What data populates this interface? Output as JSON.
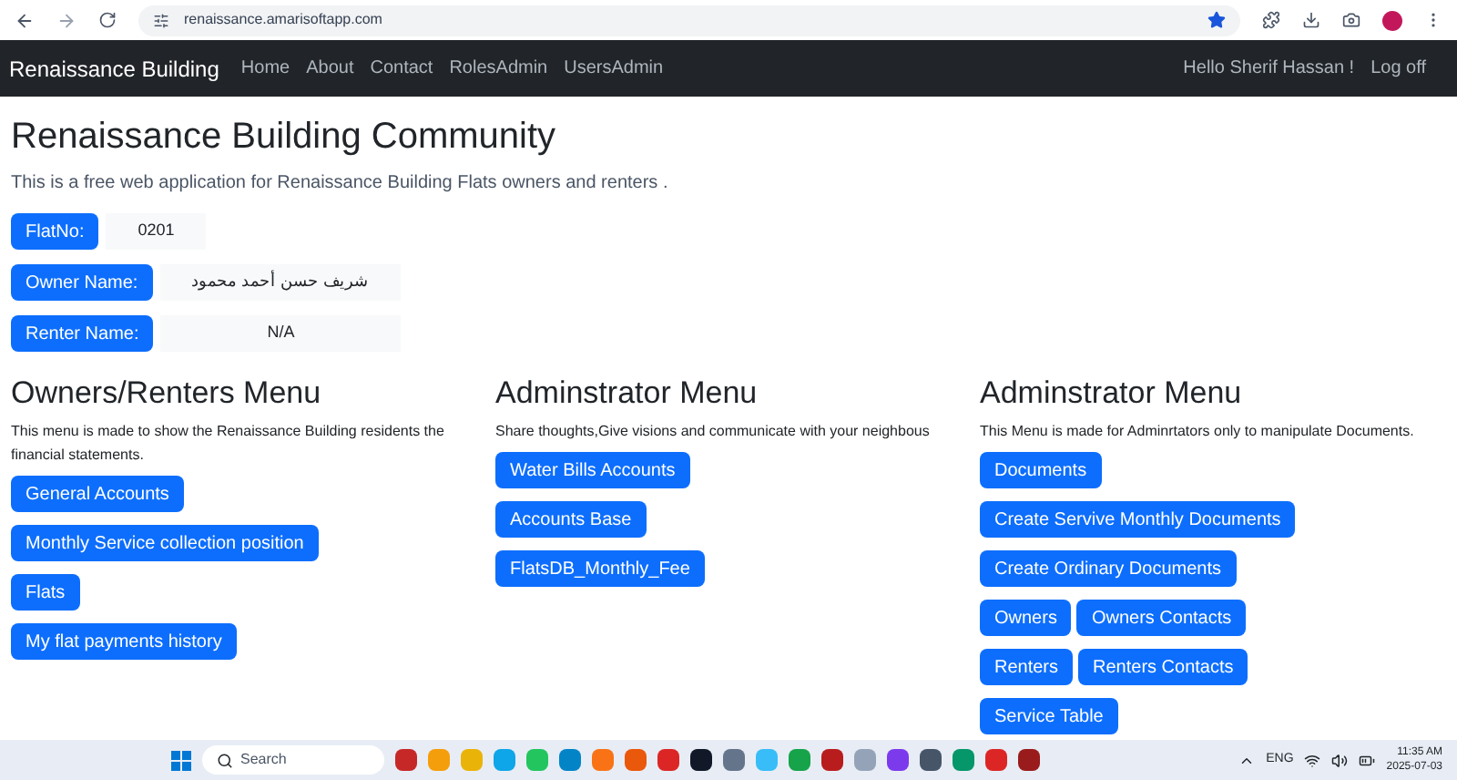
{
  "browser": {
    "url": "renaissance.amarisoftapp.com"
  },
  "navbar": {
    "brand": "Renaissance Building",
    "links": [
      "Home",
      "About",
      "Contact",
      "RolesAdmin",
      "UsersAdmin"
    ],
    "greeting": "Hello Sherif Hassan !",
    "logoff": "Log off"
  },
  "page": {
    "title": "Renaissance Building Community",
    "subtitle": "This is a free web application for Renaissance Building Flats owners and renters .",
    "fields": [
      {
        "label": "FlatNo:",
        "value": "0201"
      },
      {
        "label": "Owner Name:",
        "value": "شريف حسن أحمد محمود"
      },
      {
        "label": "Renter Name:",
        "value": "N/A"
      }
    ],
    "menus": [
      {
        "title": "Owners/Renters Menu",
        "description": "This menu is made to show the Renaissance Building residents the financial statements.",
        "rows": [
          [
            "General Accounts"
          ],
          [
            "Monthly Service collection position"
          ],
          [
            "Flats"
          ],
          [
            "My flat payments history"
          ]
        ]
      },
      {
        "title": "Adminstrator Menu",
        "description": "Share thoughts,Give visions and communicate with your neighbous",
        "rows": [
          [
            "Water Bills Accounts"
          ],
          [
            "Accounts Base"
          ],
          [
            "FlatsDB_Monthly_Fee"
          ]
        ]
      },
      {
        "title": "Adminstrator Menu",
        "description": "This Menu is made for Adminrtators only to manipulate Documents.",
        "rows": [
          [
            "Documents"
          ],
          [
            "Create Servive Monthly Documents"
          ],
          [
            "Create Ordinary Documents"
          ],
          [
            "Owners",
            "Owners Contacts"
          ],
          [
            "Renters",
            "Renters Contacts"
          ],
          [
            "Service Table"
          ]
        ]
      }
    ]
  },
  "taskbar": {
    "search_placeholder": "Search",
    "language": "ENG",
    "time": "11:35 AM",
    "date": "2025-07-03"
  }
}
